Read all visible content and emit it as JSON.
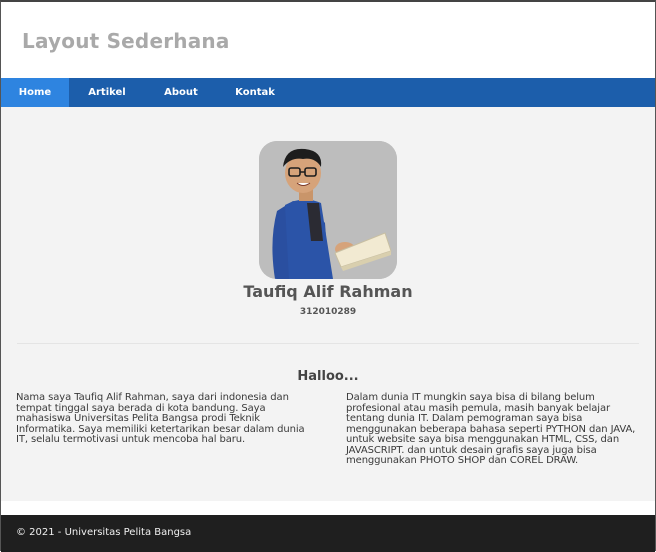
{
  "header": {
    "title": "Layout Sederhana"
  },
  "nav": {
    "items": [
      {
        "label": "Home",
        "active": true
      },
      {
        "label": "Artikel",
        "active": false
      },
      {
        "label": "About",
        "active": false
      },
      {
        "label": "Kontak",
        "active": false
      }
    ],
    "colors": {
      "bar": "#1c5eab",
      "active": "#2e84e0"
    }
  },
  "profile": {
    "name": "Taufiq Alif Rahman",
    "nim": "312010289"
  },
  "main": {
    "greeting": "Halloo...",
    "paragraph_left": "Nama saya Taufiq Alif Rahman, saya dari indonesia dan tempat tinggal saya berada di kota bandung. Saya mahasiswa Universitas Pelita Bangsa prodi Teknik Informatika. Saya memiliki ketertarikan besar dalam dunia IT, selalu termotivasi untuk mencoba hal baru.",
    "paragraph_right": "Dalam dunia IT mungkin saya bisa di bilang belum profesional atau masih pemula, masih banyak belajar tentang dunia IT. Dalam pemograman saya bisa menggunakan beberapa bahasa seperti PYTHON dan JAVA, untuk website saya bisa menggunakan HTML, CSS, dan JAVASCRIPT. dan untuk desain grafis saya juga bisa menggunakan PHOTO SHOP dan COREL DRAW."
  },
  "footer": {
    "copyright": "© 2021 - Universitas Pelita Bangsa"
  }
}
